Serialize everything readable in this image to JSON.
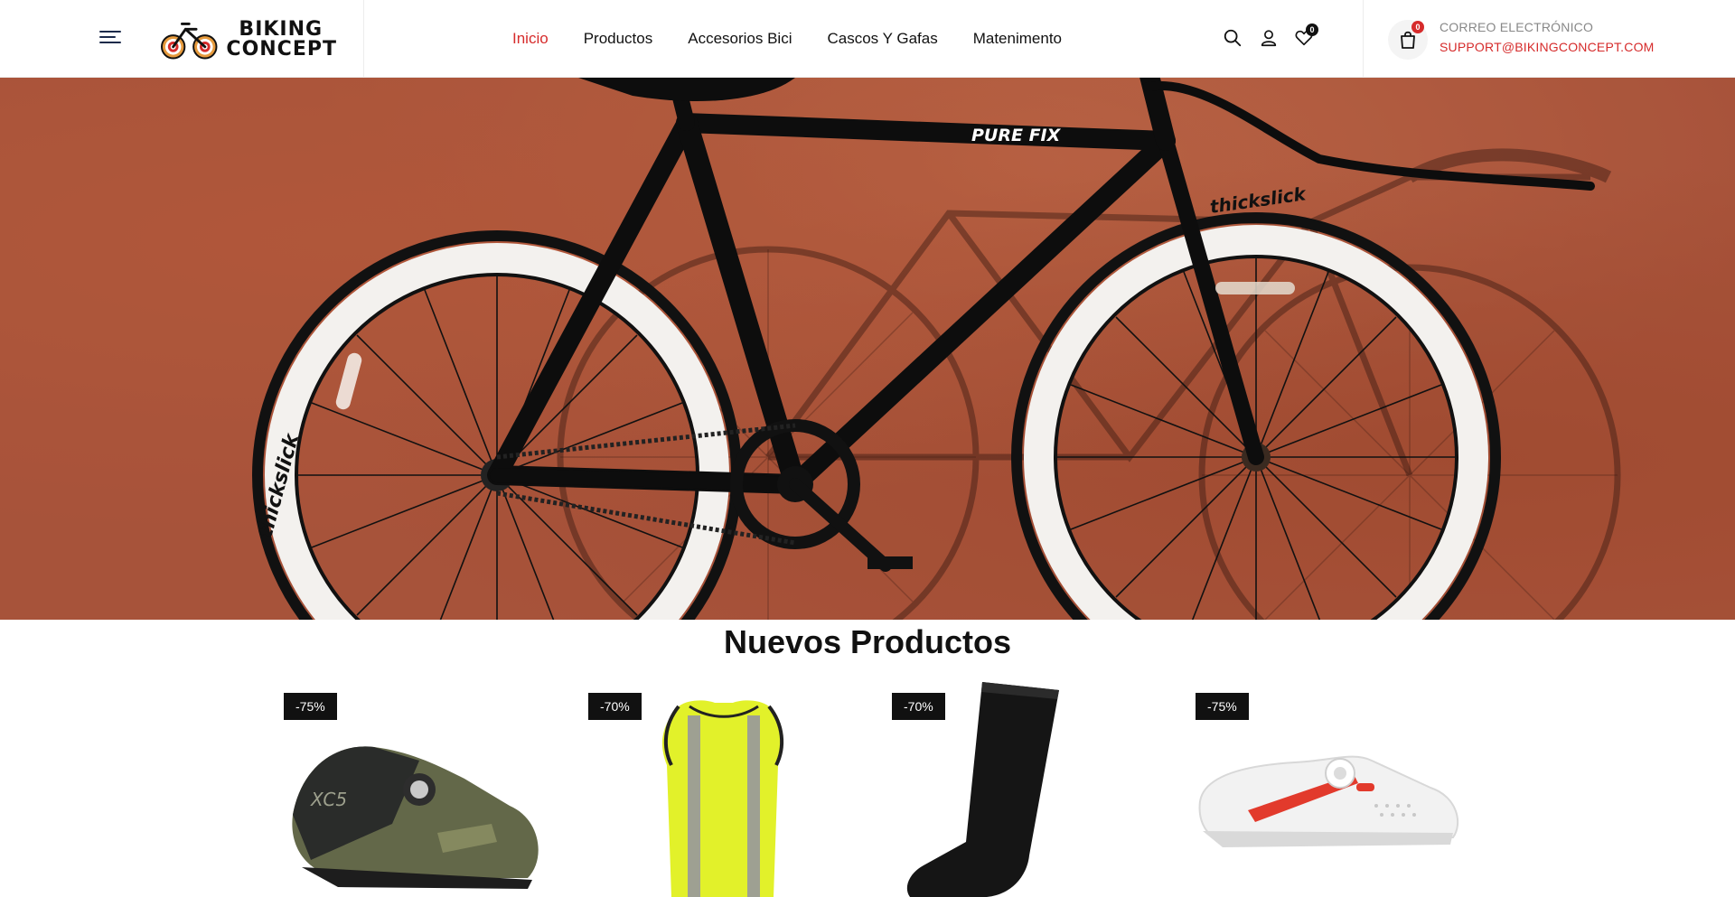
{
  "header": {
    "logo_line1": "BIKING",
    "logo_line2": "CONCEPT",
    "nav": [
      {
        "label": "Inicio",
        "active": true
      },
      {
        "label": "Productos",
        "active": false
      },
      {
        "label": "Accesorios Bici",
        "active": false
      },
      {
        "label": "Cascos Y Gafas",
        "active": false
      },
      {
        "label": "Matenimento",
        "active": false
      }
    ],
    "wishlist_count": "0",
    "cart_count": "0",
    "contact_label": "CORREO ELECTRÓNICO",
    "contact_email": "SUPPORT@BIKINGCONCEPT.COM",
    "accent_color": "#d62b2b"
  },
  "hero": {
    "frame_brand": "PURE FIX",
    "tire_brand": "thickslick"
  },
  "new_products": {
    "title": "Nuevos Productos",
    "items": [
      {
        "badge": "-75%",
        "image": "shoe-olive-xc5"
      },
      {
        "badge": "-70%",
        "image": "vest-hi-vis-yellow"
      },
      {
        "badge": "-70%",
        "image": "sock-black"
      },
      {
        "badge": "-75%",
        "image": "shoe-white-road"
      }
    ]
  }
}
